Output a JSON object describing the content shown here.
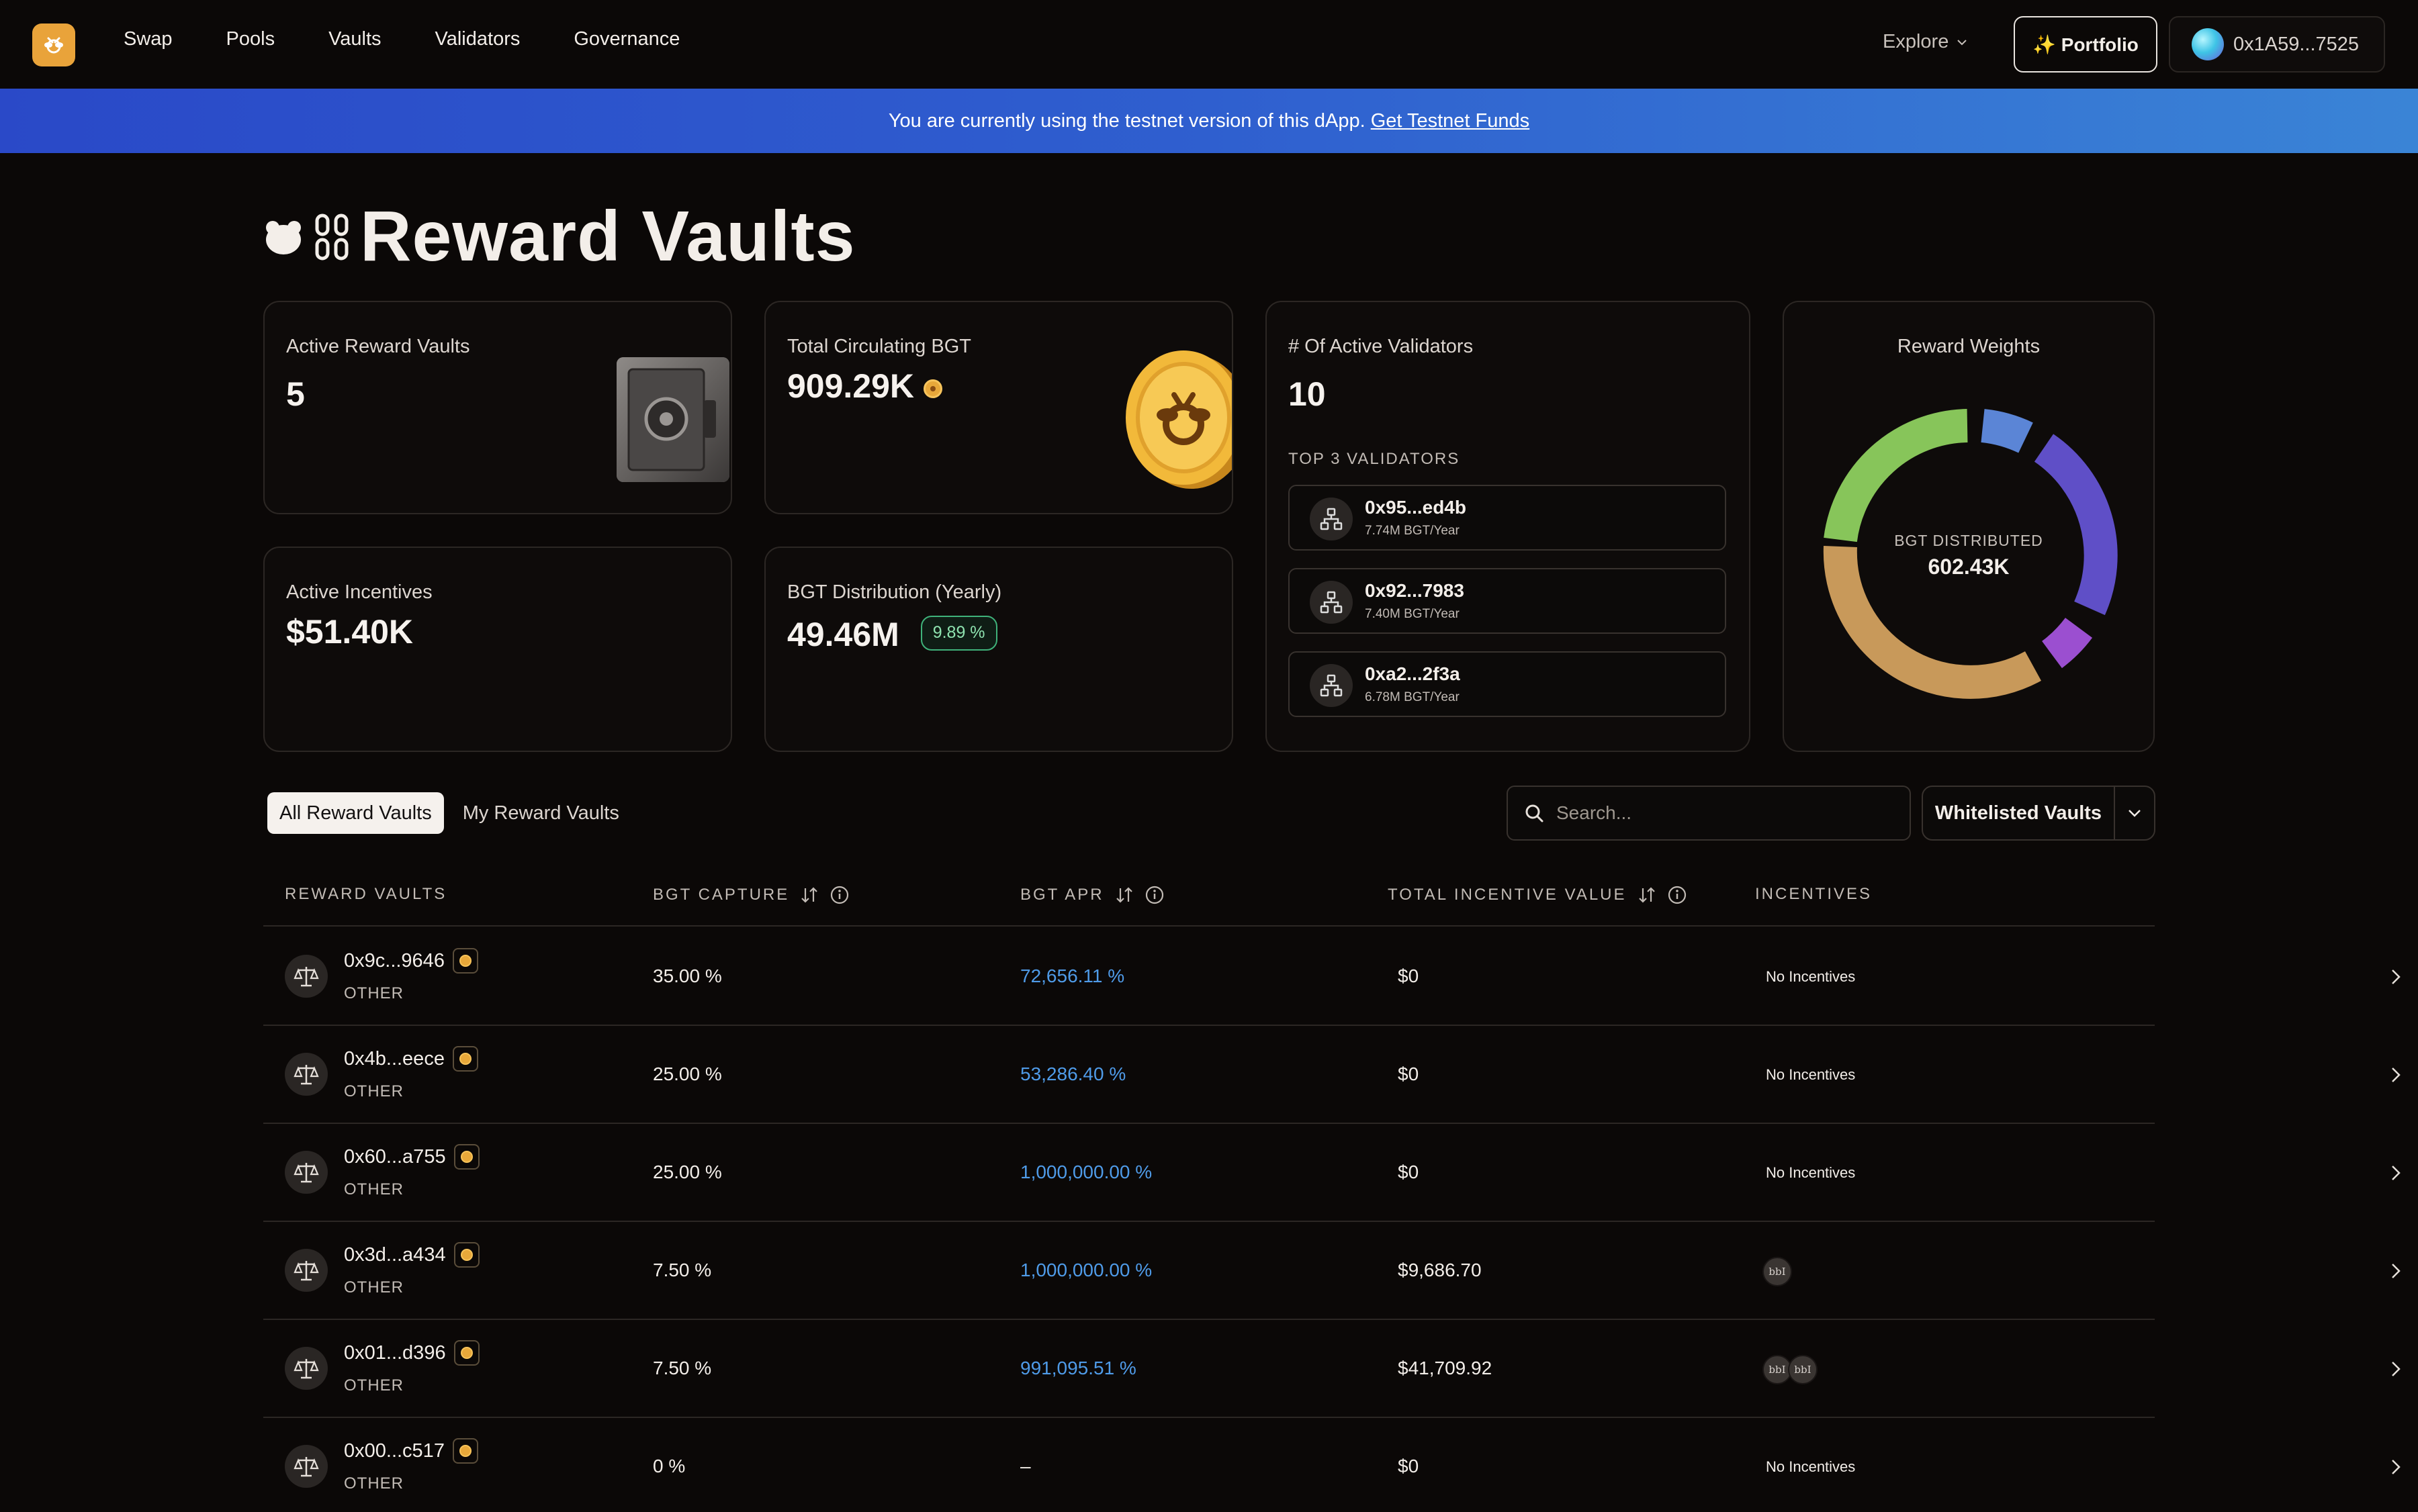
{
  "nav": {
    "links": [
      "Swap",
      "Pools",
      "Vaults",
      "Validators",
      "Governance"
    ],
    "explore": "Explore",
    "portfolio": "✨ Portfolio",
    "wallet": "0x1A59...7525"
  },
  "banner": {
    "text": "You are currently using the testnet version of this dApp.",
    "link": "Get Testnet Funds"
  },
  "page": {
    "title": "Reward Vaults"
  },
  "stats": {
    "active_vaults": {
      "label": "Active Reward Vaults",
      "value": "5"
    },
    "circulating": {
      "label": "Total Circulating BGT",
      "value": "909.29K"
    },
    "incentives": {
      "label": "Active Incentives",
      "value": "$51.40K"
    },
    "distribution": {
      "label": "BGT Distribution (Yearly)",
      "value": "49.46M",
      "badge": "9.89 %"
    },
    "validators": {
      "label": "# Of Active Validators",
      "value": "10",
      "top_label": "TOP 3 VALIDATORS",
      "top": [
        {
          "address": "0x95...ed4b",
          "rate": "7.74M BGT/Year"
        },
        {
          "address": "0x92...7983",
          "rate": "7.40M BGT/Year"
        },
        {
          "address": "0xa2...2f3a",
          "rate": "6.78M BGT/Year"
        }
      ]
    },
    "weights": {
      "title": "Reward Weights",
      "center_label": "BGT DISTRIBUTED",
      "center_value": "602.43K",
      "colors": [
        "#5b85d6",
        "#5f4fc7",
        "#9b4fd0",
        "#c8995a",
        "#87c55a"
      ]
    }
  },
  "tabs": {
    "all": "All Reward Vaults",
    "mine": "My Reward Vaults"
  },
  "search": {
    "placeholder": "Search..."
  },
  "filter": {
    "selected": "Whitelisted Vaults"
  },
  "table": {
    "headers": {
      "vaults": "REWARD VAULTS",
      "capture": "BGT CAPTURE",
      "apr": "BGT APR",
      "incentive_value": "TOTAL INCENTIVE VALUE",
      "incentives": "INCENTIVES"
    },
    "rows": [
      {
        "name": "0x9c...9646",
        "type": "OTHER",
        "capture": "35.00 %",
        "apr": "72,656.11 %",
        "value": "$0",
        "incentives": "No Incentives",
        "chips": []
      },
      {
        "name": "0x4b...eece",
        "type": "OTHER",
        "capture": "25.00 %",
        "apr": "53,286.40 %",
        "value": "$0",
        "incentives": "No Incentives",
        "chips": []
      },
      {
        "name": "0x60...a755",
        "type": "OTHER",
        "capture": "25.00 %",
        "apr": "1,000,000.00 %",
        "value": "$0",
        "incentives": "No Incentives",
        "chips": []
      },
      {
        "name": "0x3d...a434",
        "type": "OTHER",
        "capture": "7.50 %",
        "apr": "1,000,000.00 %",
        "value": "$9,686.70",
        "incentives": "",
        "chips": [
          "bbI"
        ]
      },
      {
        "name": "0x01...d396",
        "type": "OTHER",
        "capture": "7.50 %",
        "apr": "991,095.51 %",
        "value": "$41,709.92",
        "incentives": "",
        "chips": [
          "bbI",
          "bbI"
        ]
      },
      {
        "name": "0x00...c517",
        "type": "OTHER",
        "capture": "0 %",
        "apr": "–",
        "value": "$0",
        "incentives": "No Incentives",
        "chips": []
      }
    ]
  }
}
